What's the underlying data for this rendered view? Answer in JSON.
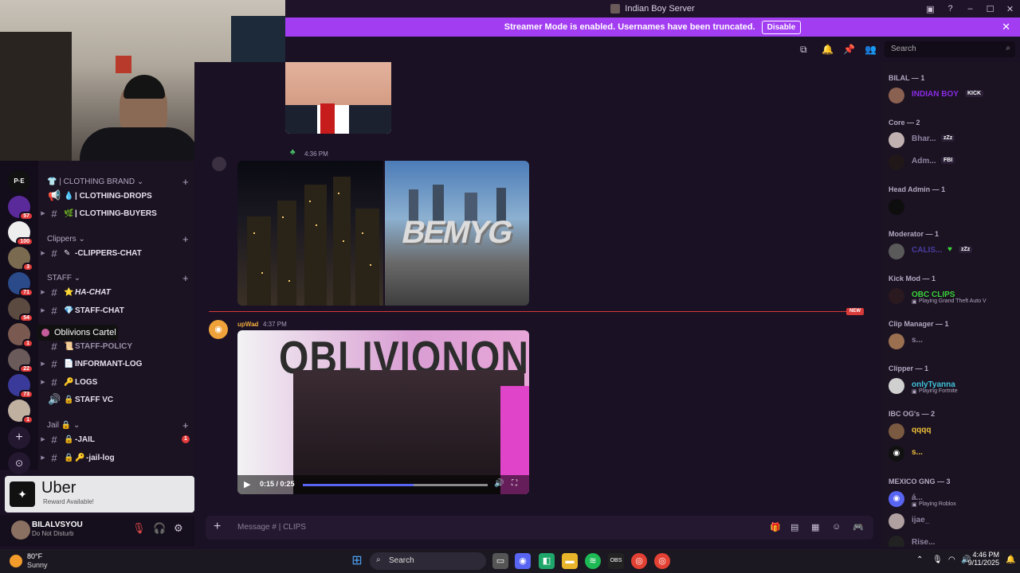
{
  "window": {
    "title": "Indian Boy Server"
  },
  "banner": {
    "text": "Streamer Mode is enabled. Usernames have been truncated.",
    "disable_label": "Disable"
  },
  "servers": [
    {
      "badge": ""
    },
    {
      "badge": "57"
    },
    {
      "badge": "100"
    },
    {
      "badge": "3"
    },
    {
      "badge": "71"
    },
    {
      "badge": "54"
    },
    {
      "badge": "1"
    },
    {
      "badge": "22"
    },
    {
      "badge": "73"
    },
    {
      "badge": "1"
    }
  ],
  "tooltip": {
    "text": "Oblivions Cartel"
  },
  "categories": {
    "clothing_brand": "| CLOTHING BRAND",
    "clippers": "Clippers",
    "staff": "STAFF",
    "jail": "Jail"
  },
  "channels": {
    "clothing_drops": "| CLOTHING-DROPS",
    "clothing_buyers": "| CLOTHING-BUYERS",
    "clippers_chat": "-CLIPPERS-CHAT",
    "ha_chat": "HA-CHAT",
    "staff_chat": "STAFF-CHAT",
    "staff_policy": "STAFF-POLICY",
    "informant_log": "INFORMANT-LOG",
    "logs": "LOGS",
    "staff_vc": "STAFF VC",
    "jail": "-JAIL",
    "jail_unread": "1",
    "jail_log": "-jail-log"
  },
  "uber": {
    "brand": "Uber",
    "sub": "Reward Available!"
  },
  "user": {
    "name": "BILALVSYOU",
    "status": "Do Not Disturb"
  },
  "header": {
    "search_placeholder": "Search"
  },
  "messages": {
    "time1": "4:36 PM",
    "new_label": "NEW",
    "author2": "upWa̶d",
    "time2": "4:37 PM",
    "image_text": "BEMYG",
    "video_title": "OBLIVIONON",
    "video_time": "0:15 / 0:25",
    "video_progress": 0.6
  },
  "composer": {
    "placeholder": "Message # | CLIPS"
  },
  "members": {
    "roles": [
      {
        "label": "BILAL — 1"
      },
      {
        "label": "Core — 2"
      },
      {
        "label": "Head Admin — 1"
      },
      {
        "label": "Moderator — 1"
      },
      {
        "label": "Kick Mod — 1"
      },
      {
        "label": "Clip Manager — 1"
      },
      {
        "label": "Clipper — 1"
      },
      {
        "label": "IBC OG's — 2"
      },
      {
        "label": "MEXICO GNG — 3"
      }
    ],
    "list": [
      {
        "name": "INDIAN BOY",
        "tag": "KICK",
        "activity": "",
        "color": "#8a2be2"
      },
      {
        "name": "Bhar...",
        "tag": "zZz",
        "activity": "",
        "color": "#8e86a0"
      },
      {
        "name": "Adm...",
        "tag": "FBI",
        "activity": "",
        "color": "#8e86a0"
      },
      {
        "name": "",
        "tag": "",
        "activity": "",
        "color": "#8e86a0"
      },
      {
        "name": "CALIS...",
        "tag": "zZz",
        "activity": "",
        "color": "#4a3fa0"
      },
      {
        "name": "OBC CLIPS",
        "tag": "",
        "activity": "Playing Grand Theft Auto V",
        "color": "#3ad23a"
      },
      {
        "name": "s...",
        "tag": "",
        "activity": "",
        "color": "#8e86a0"
      },
      {
        "name": "onlyTyanna",
        "tag": "",
        "activity": "Playing Fortnite",
        "color": "#3fc2d9"
      },
      {
        "name": "qqqq",
        "tag": "",
        "activity": "",
        "color": "#f0c23a"
      },
      {
        "name": "s...",
        "tag": "",
        "activity": "",
        "color": "#f0c23a"
      },
      {
        "name": "á...",
        "tag": "",
        "activity": "Playing Roblox",
        "color": "#8e86a0"
      },
      {
        "name": "ijae_",
        "tag": "",
        "activity": "",
        "color": "#8e86a0"
      },
      {
        "name": "Rise...",
        "tag": "",
        "activity": "",
        "color": "#8e86a0"
      }
    ]
  },
  "taskbar": {
    "temp": "80°F",
    "condition": "Sunny",
    "search": "Search",
    "time": "4:46 PM",
    "date": "9/11/2025"
  }
}
